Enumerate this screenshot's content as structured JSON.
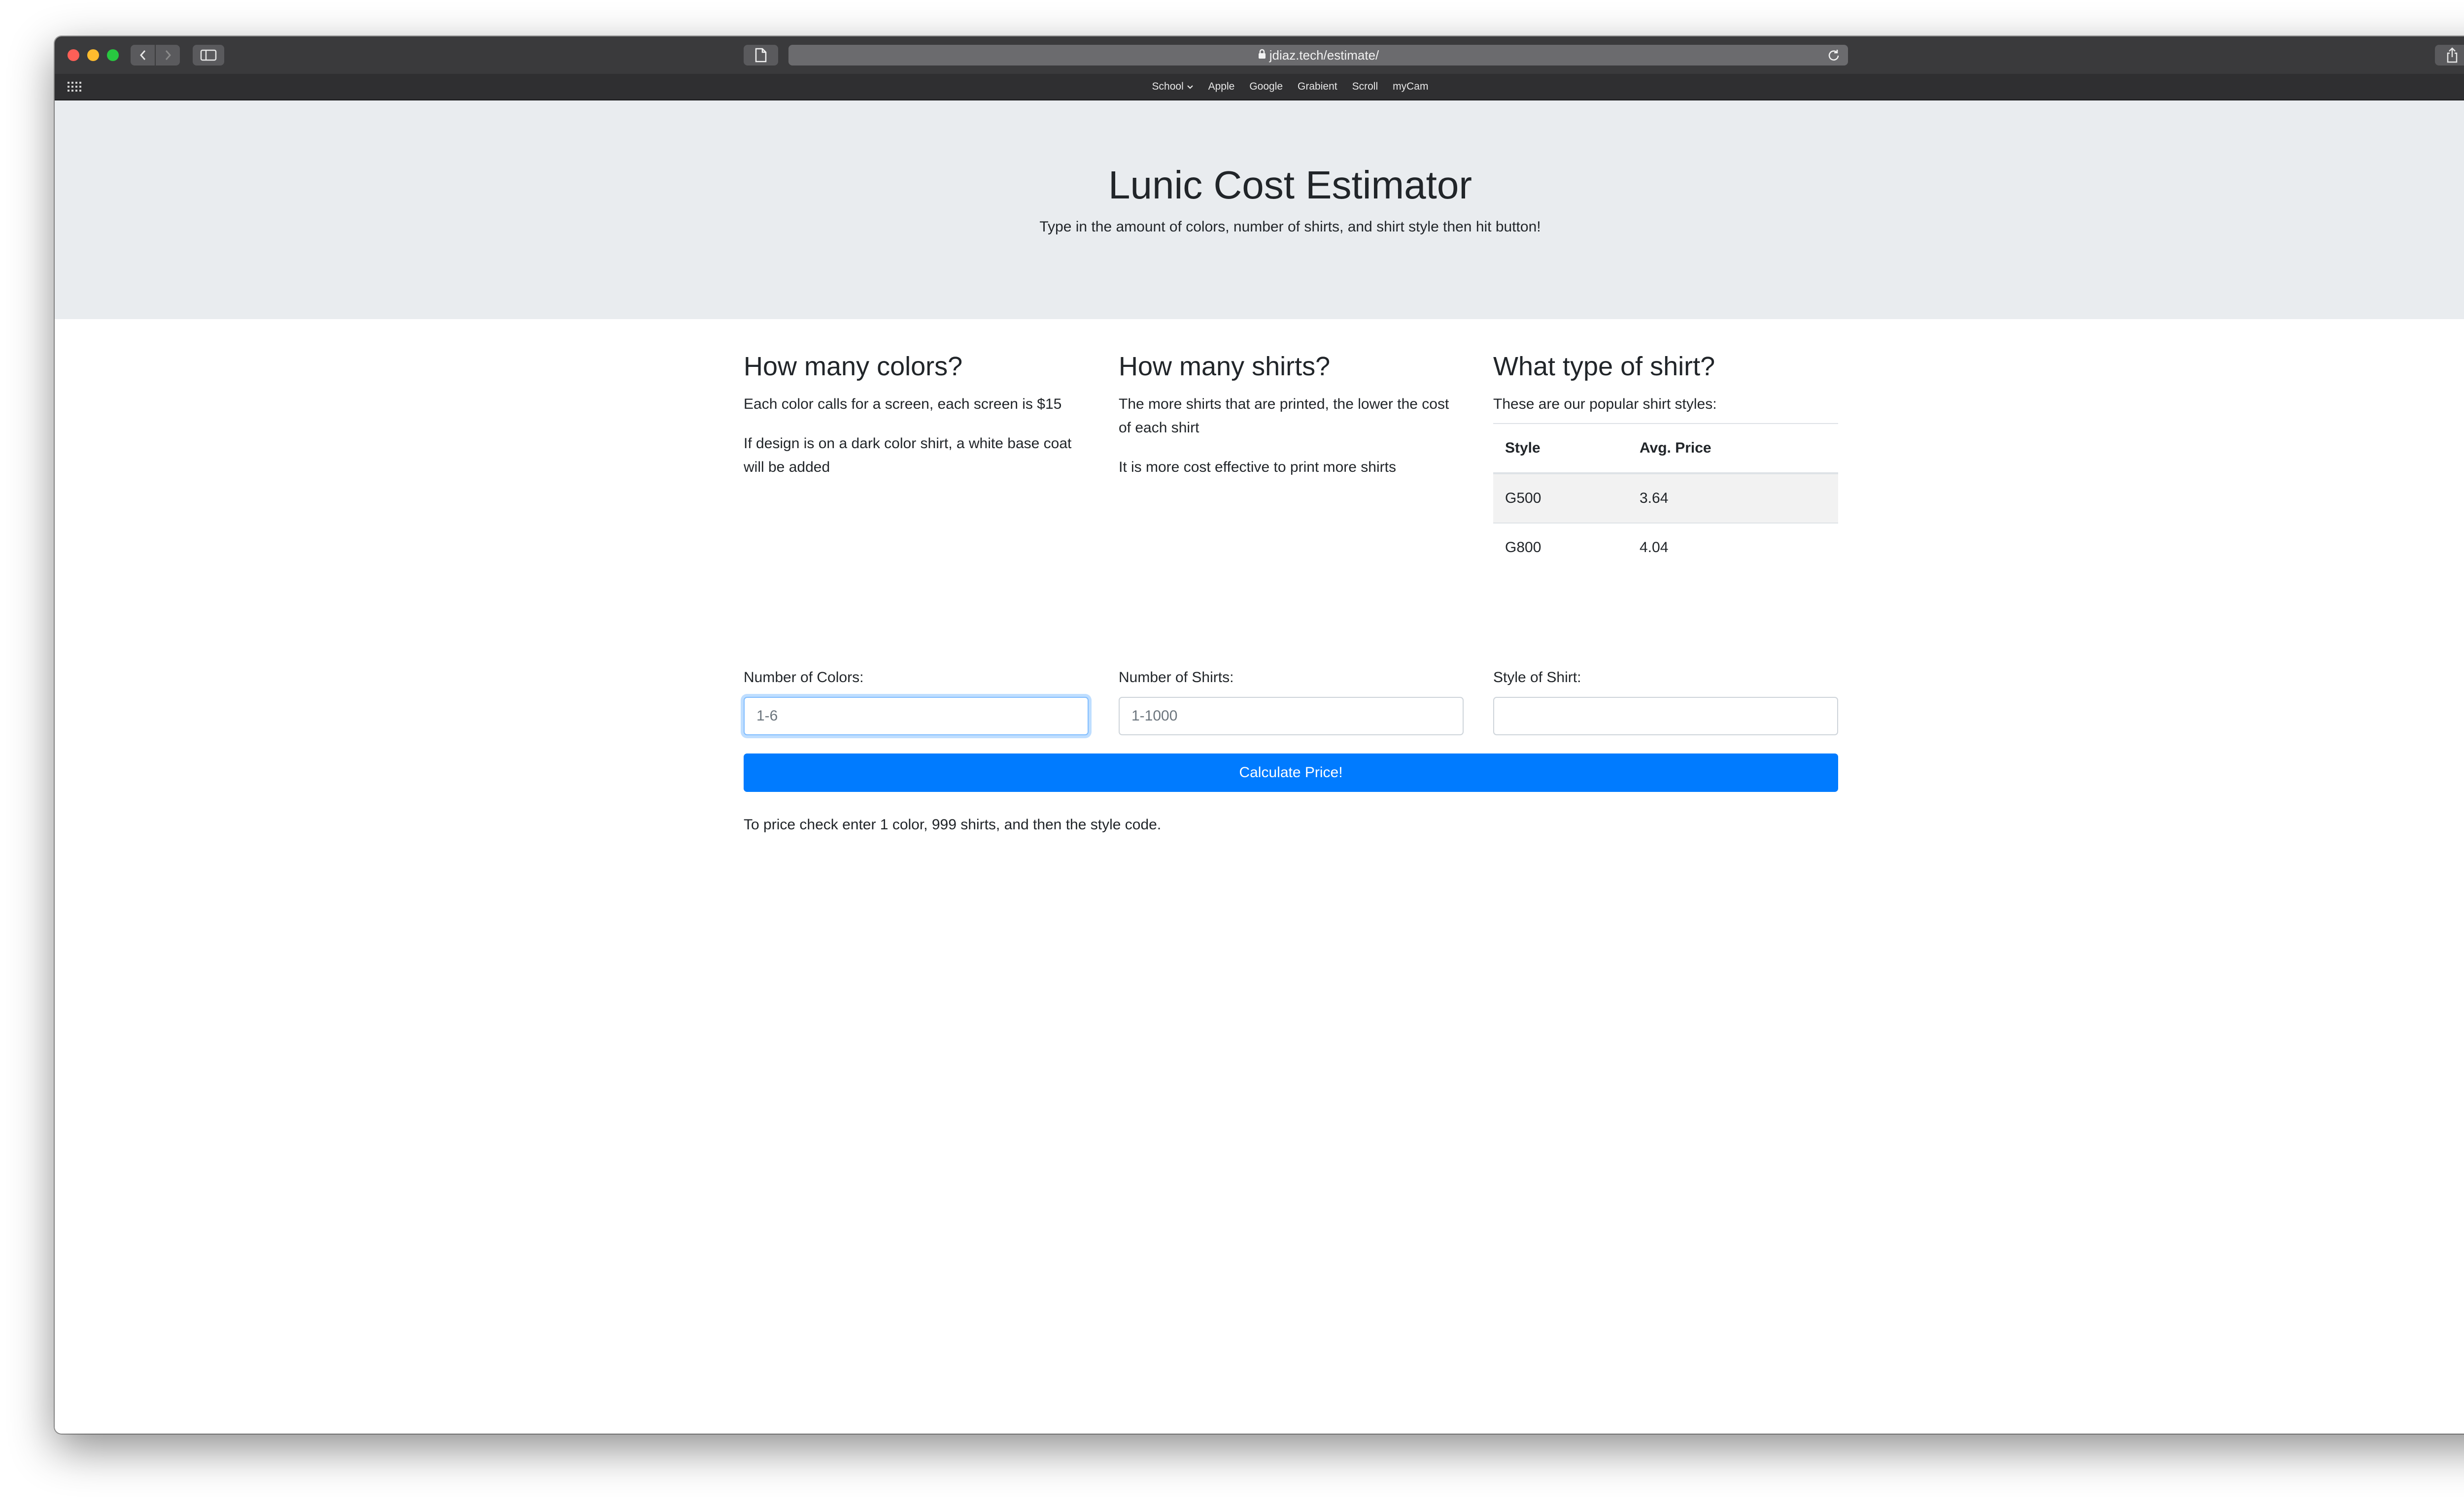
{
  "browser": {
    "url": "jdiaz.tech/estimate/",
    "favorites": [
      {
        "label": "School",
        "has_dropdown": true
      },
      {
        "label": "Apple"
      },
      {
        "label": "Google"
      },
      {
        "label": "Grabient"
      },
      {
        "label": "Scroll"
      },
      {
        "label": "myCam"
      }
    ],
    "colors": {
      "titlebar": "#3a3a3c",
      "close": "#ff5f57",
      "minimize": "#febc2e",
      "maximize": "#28c840"
    }
  },
  "header": {
    "title": "Lunic Cost Estimator",
    "subtitle": "Type in the amount of colors, number of shirts, and shirt style then hit button!"
  },
  "columns": {
    "colors": {
      "heading": "How many colors?",
      "paragraphs": [
        "Each color calls for a screen, each screen is $15",
        "If design is on a dark color shirt, a white base coat will be added"
      ]
    },
    "shirts": {
      "heading": "How many shirts?",
      "paragraphs": [
        "The more shirts that are printed, the lower the cost of each shirt",
        "It is more cost effective to print more shirts"
      ]
    },
    "style": {
      "heading": "What type of shirt?",
      "paragraphs": [
        "These are our popular shirt styles:"
      ],
      "table": {
        "headers": [
          "Style",
          "Avg. Price"
        ],
        "rows": [
          [
            "G500",
            "3.64"
          ],
          [
            "G800",
            "4.04"
          ]
        ]
      }
    }
  },
  "form": {
    "colors": {
      "label": "Number of Colors:",
      "placeholder": "1-6",
      "value": ""
    },
    "shirts": {
      "label": "Number of Shirts:",
      "placeholder": "1-1000",
      "value": ""
    },
    "style": {
      "label": "Style of Shirt:",
      "placeholder": "",
      "value": ""
    },
    "submit_label": "Calculate Price!",
    "accent": "#007bff"
  },
  "note": "To price check enter 1 color, 999 shirts, and then the style code."
}
